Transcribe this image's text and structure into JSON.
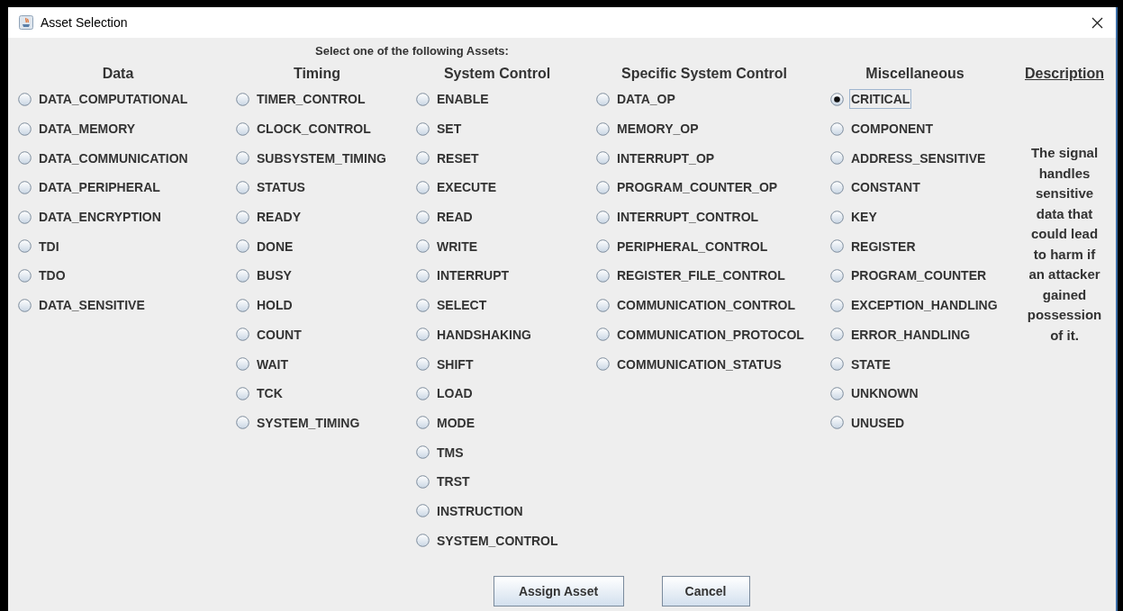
{
  "window": {
    "title": "Asset Selection"
  },
  "prompt": "Select one of the following Assets:",
  "groups": [
    {
      "heading": "Data",
      "options": [
        {
          "label": "DATA_COMPUTATIONAL",
          "selected": false
        },
        {
          "label": "DATA_MEMORY",
          "selected": false
        },
        {
          "label": "DATA_COMMUNICATION",
          "selected": false
        },
        {
          "label": "DATA_PERIPHERAL",
          "selected": false
        },
        {
          "label": "DATA_ENCRYPTION",
          "selected": false
        },
        {
          "label": "TDI",
          "selected": false
        },
        {
          "label": "TDO",
          "selected": false
        },
        {
          "label": "DATA_SENSITIVE",
          "selected": false
        }
      ]
    },
    {
      "heading": "Timing",
      "options": [
        {
          "label": "TIMER_CONTROL",
          "selected": false
        },
        {
          "label": "CLOCK_CONTROL",
          "selected": false
        },
        {
          "label": "SUBSYSTEM_TIMING",
          "selected": false
        },
        {
          "label": "STATUS",
          "selected": false
        },
        {
          "label": "READY",
          "selected": false
        },
        {
          "label": "DONE",
          "selected": false
        },
        {
          "label": "BUSY",
          "selected": false
        },
        {
          "label": "HOLD",
          "selected": false
        },
        {
          "label": "COUNT",
          "selected": false
        },
        {
          "label": "WAIT",
          "selected": false
        },
        {
          "label": "TCK",
          "selected": false
        },
        {
          "label": "SYSTEM_TIMING",
          "selected": false
        }
      ]
    },
    {
      "heading": "System Control",
      "options": [
        {
          "label": "ENABLE",
          "selected": false
        },
        {
          "label": "SET",
          "selected": false
        },
        {
          "label": "RESET",
          "selected": false
        },
        {
          "label": "EXECUTE",
          "selected": false
        },
        {
          "label": "READ",
          "selected": false
        },
        {
          "label": "WRITE",
          "selected": false
        },
        {
          "label": "INTERRUPT",
          "selected": false
        },
        {
          "label": "SELECT",
          "selected": false
        },
        {
          "label": "HANDSHAKING",
          "selected": false
        },
        {
          "label": "SHIFT",
          "selected": false
        },
        {
          "label": "LOAD",
          "selected": false
        },
        {
          "label": "MODE",
          "selected": false
        },
        {
          "label": "TMS",
          "selected": false
        },
        {
          "label": "TRST",
          "selected": false
        },
        {
          "label": "INSTRUCTION",
          "selected": false
        },
        {
          "label": "SYSTEM_CONTROL",
          "selected": false
        }
      ]
    },
    {
      "heading": "Specific System Control",
      "options": [
        {
          "label": "DATA_OP",
          "selected": false
        },
        {
          "label": "MEMORY_OP",
          "selected": false
        },
        {
          "label": "INTERRUPT_OP",
          "selected": false
        },
        {
          "label": "PROGRAM_COUNTER_OP",
          "selected": false
        },
        {
          "label": "INTERRUPT_CONTROL",
          "selected": false
        },
        {
          "label": "PERIPHERAL_CONTROL",
          "selected": false
        },
        {
          "label": "REGISTER_FILE_CONTROL",
          "selected": false
        },
        {
          "label": "COMMUNICATION_CONTROL",
          "selected": false
        },
        {
          "label": "COMMUNICATION_PROTOCOL",
          "selected": false
        },
        {
          "label": "COMMUNICATION_STATUS",
          "selected": false
        }
      ]
    },
    {
      "heading": "Miscellaneous",
      "options": [
        {
          "label": "CRITICAL",
          "selected": true
        },
        {
          "label": "COMPONENT",
          "selected": false
        },
        {
          "label": "ADDRESS_SENSITIVE",
          "selected": false
        },
        {
          "label": "CONSTANT",
          "selected": false
        },
        {
          "label": "KEY",
          "selected": false
        },
        {
          "label": "REGISTER",
          "selected": false
        },
        {
          "label": "PROGRAM_COUNTER",
          "selected": false
        },
        {
          "label": "EXCEPTION_HANDLING",
          "selected": false
        },
        {
          "label": "ERROR_HANDLING",
          "selected": false
        },
        {
          "label": "STATE",
          "selected": false
        },
        {
          "label": "UNKNOWN",
          "selected": false
        },
        {
          "label": "UNUSED",
          "selected": false
        }
      ]
    }
  ],
  "description": {
    "heading": "Description",
    "text": "The signal handles sensitive data that could lead to harm if an attacker gained possession of it."
  },
  "buttons": [
    "Assign Asset",
    "Cancel"
  ]
}
